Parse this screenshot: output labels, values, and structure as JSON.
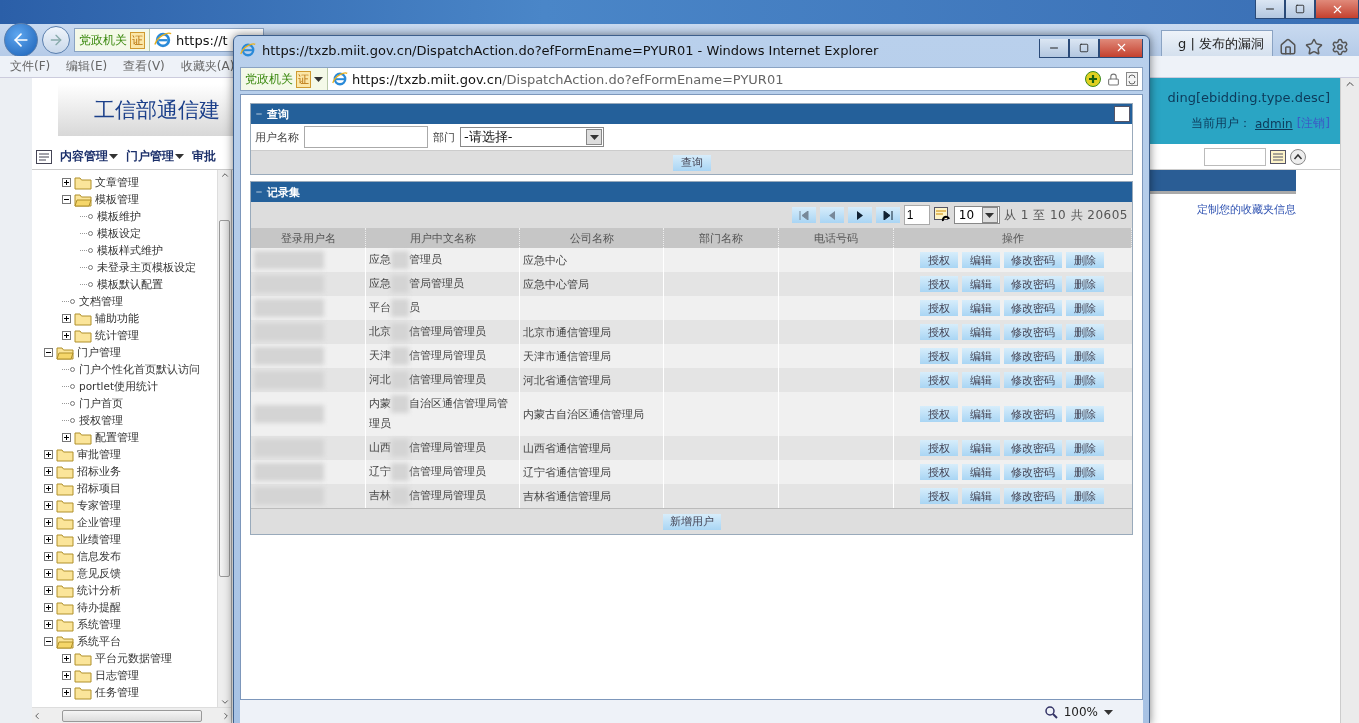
{
  "browser": {
    "security": "党政机关",
    "badge": "证",
    "address": "https://t",
    "tab": "g | 发布的漏洞",
    "menu": [
      "文件(F)",
      "编辑(E)",
      "查看(V)",
      "收藏夹(A)"
    ]
  },
  "page": {
    "banner_title": "工信部通信建",
    "nav": [
      {
        "label": "内容管理",
        "dropdown": true
      },
      {
        "label": "门户管理",
        "dropdown": true
      },
      {
        "label": "审批",
        "dropdown": false
      }
    ],
    "header_text": "ding[ebidding.type.desc]",
    "user_label": "当前用户：",
    "user": "admin",
    "logout": "[注销]",
    "favorites_link": "定制您的收藏夹信息"
  },
  "tree": {
    "scrolled_branch": [
      {
        "label": "文章管理",
        "kind": "folder",
        "expanded": false
      },
      {
        "label": "模板管理",
        "kind": "folder",
        "expanded": true,
        "children": [
          {
            "label": "模板维护",
            "kind": "leaf"
          },
          {
            "label": "模板设定",
            "kind": "leaf"
          },
          {
            "label": "模板样式维护",
            "kind": "leaf"
          },
          {
            "label": "未登录主页模板设定",
            "kind": "leaf"
          },
          {
            "label": "模板默认配置",
            "kind": "leaf"
          }
        ]
      },
      {
        "label": "文档管理",
        "kind": "leaf"
      },
      {
        "label": "辅助功能",
        "kind": "folder",
        "expanded": false
      },
      {
        "label": "统计管理",
        "kind": "folder",
        "expanded": false
      }
    ],
    "items": [
      {
        "label": "门户管理",
        "kind": "folder",
        "expanded": true,
        "children": [
          {
            "label": "门户个性化首页默认访问",
            "kind": "leaf"
          },
          {
            "label": "portlet使用统计",
            "kind": "leaf"
          },
          {
            "label": "门户首页",
            "kind": "leaf"
          },
          {
            "label": "授权管理",
            "kind": "leaf"
          },
          {
            "label": "配置管理",
            "kind": "folder",
            "expanded": false
          }
        ]
      },
      {
        "label": "审批管理",
        "kind": "folder",
        "expanded": false
      },
      {
        "label": "招标业务",
        "kind": "folder",
        "expanded": false
      },
      {
        "label": "招标项目",
        "kind": "folder",
        "expanded": false
      },
      {
        "label": "专家管理",
        "kind": "folder",
        "expanded": false
      },
      {
        "label": "企业管理",
        "kind": "folder",
        "expanded": false
      },
      {
        "label": "业绩管理",
        "kind": "folder",
        "expanded": false
      },
      {
        "label": "信息发布",
        "kind": "folder",
        "expanded": false
      },
      {
        "label": "意见反馈",
        "kind": "folder",
        "expanded": false
      },
      {
        "label": "统计分析",
        "kind": "folder",
        "expanded": false
      },
      {
        "label": "待办提醒",
        "kind": "folder",
        "expanded": false
      },
      {
        "label": "系统管理",
        "kind": "folder",
        "expanded": false
      },
      {
        "label": "系统平台",
        "kind": "folder",
        "expanded": true,
        "children": [
          {
            "label": "平台元数据管理",
            "kind": "folder",
            "expanded": false
          },
          {
            "label": "日志管理",
            "kind": "folder",
            "expanded": false
          },
          {
            "label": "任务管理",
            "kind": "folder",
            "expanded": false
          }
        ]
      }
    ]
  },
  "popup": {
    "title": "https://txzb.miit.gov.cn/DispatchAction.do?efFormEname=PYUR01 - Windows Internet Explorer",
    "security": "党政机关",
    "badge": "证",
    "address_host": "https://txzb.miit.gov.cn",
    "address_path": "/DispatchAction.do?efFormEname=PYUR01",
    "zoom": "100%",
    "query": {
      "title": "查询",
      "fields": [
        {
          "label": "用户名称",
          "kind": "text"
        },
        {
          "label": "部门",
          "kind": "select",
          "value": "-请选择-"
        }
      ],
      "button": "查询"
    },
    "records": {
      "title": "记录集",
      "pager": {
        "page": "1",
        "page_size": "10",
        "summary": "从 1 至 10 共 20605"
      },
      "columns": [
        "登录用户名",
        "用户中文名称",
        "公司名称",
        "部门名称",
        "电话号码",
        "操作"
      ],
      "rows": [
        {
          "name_start": "应急",
          "name_end": "管理员",
          "company": "应急中心",
          "actions": [
            "授权",
            "编辑",
            "修改密码",
            "删除"
          ]
        },
        {
          "name_start": "应急",
          "name_end": "管局管理员",
          "company": "应急中心管局",
          "actions": [
            "授权",
            "编辑",
            "修改密码",
            "删除"
          ]
        },
        {
          "name_start": "平台",
          "name_end": "员",
          "actions": [
            "授权",
            "编辑",
            "修改密码",
            "删除"
          ]
        },
        {
          "name_start": "北京",
          "name_end": "信管理局管理员",
          "company": "北京市通信管理局",
          "actions": [
            "授权",
            "编辑",
            "修改密码",
            "删除"
          ]
        },
        {
          "name_start": "天津",
          "name_end": "信管理局管理员",
          "company": "天津市通信管理局",
          "actions": [
            "授权",
            "编辑",
            "修改密码",
            "删除"
          ]
        },
        {
          "name_start": "河北",
          "name_end": "信管理局管理员",
          "company": "河北省通信管理局",
          "actions": [
            "授权",
            "编辑",
            "修改密码",
            "删除"
          ]
        },
        {
          "name_start": "内蒙",
          "name_end": "自治区通信管理局管理员",
          "company": "内蒙古自治区通信管理局",
          "actions": [
            "授权",
            "编辑",
            "修改密码",
            "删除"
          ]
        },
        {
          "name_start": "山西",
          "name_end": "信管理局管理员",
          "company": "山西省通信管理局",
          "actions": [
            "授权",
            "编辑",
            "修改密码",
            "删除"
          ]
        },
        {
          "name_start": "辽宁",
          "name_end": "信管理局管理员",
          "company": "辽宁省通信管理局",
          "actions": [
            "授权",
            "编辑",
            "修改密码",
            "删除"
          ]
        },
        {
          "name_start": "吉林",
          "name_end": "信管理局管理员",
          "company": "吉林省通信管理局",
          "actions": [
            "授权",
            "编辑",
            "修改密码",
            "删除"
          ]
        }
      ],
      "add_button": "新增用户"
    }
  }
}
